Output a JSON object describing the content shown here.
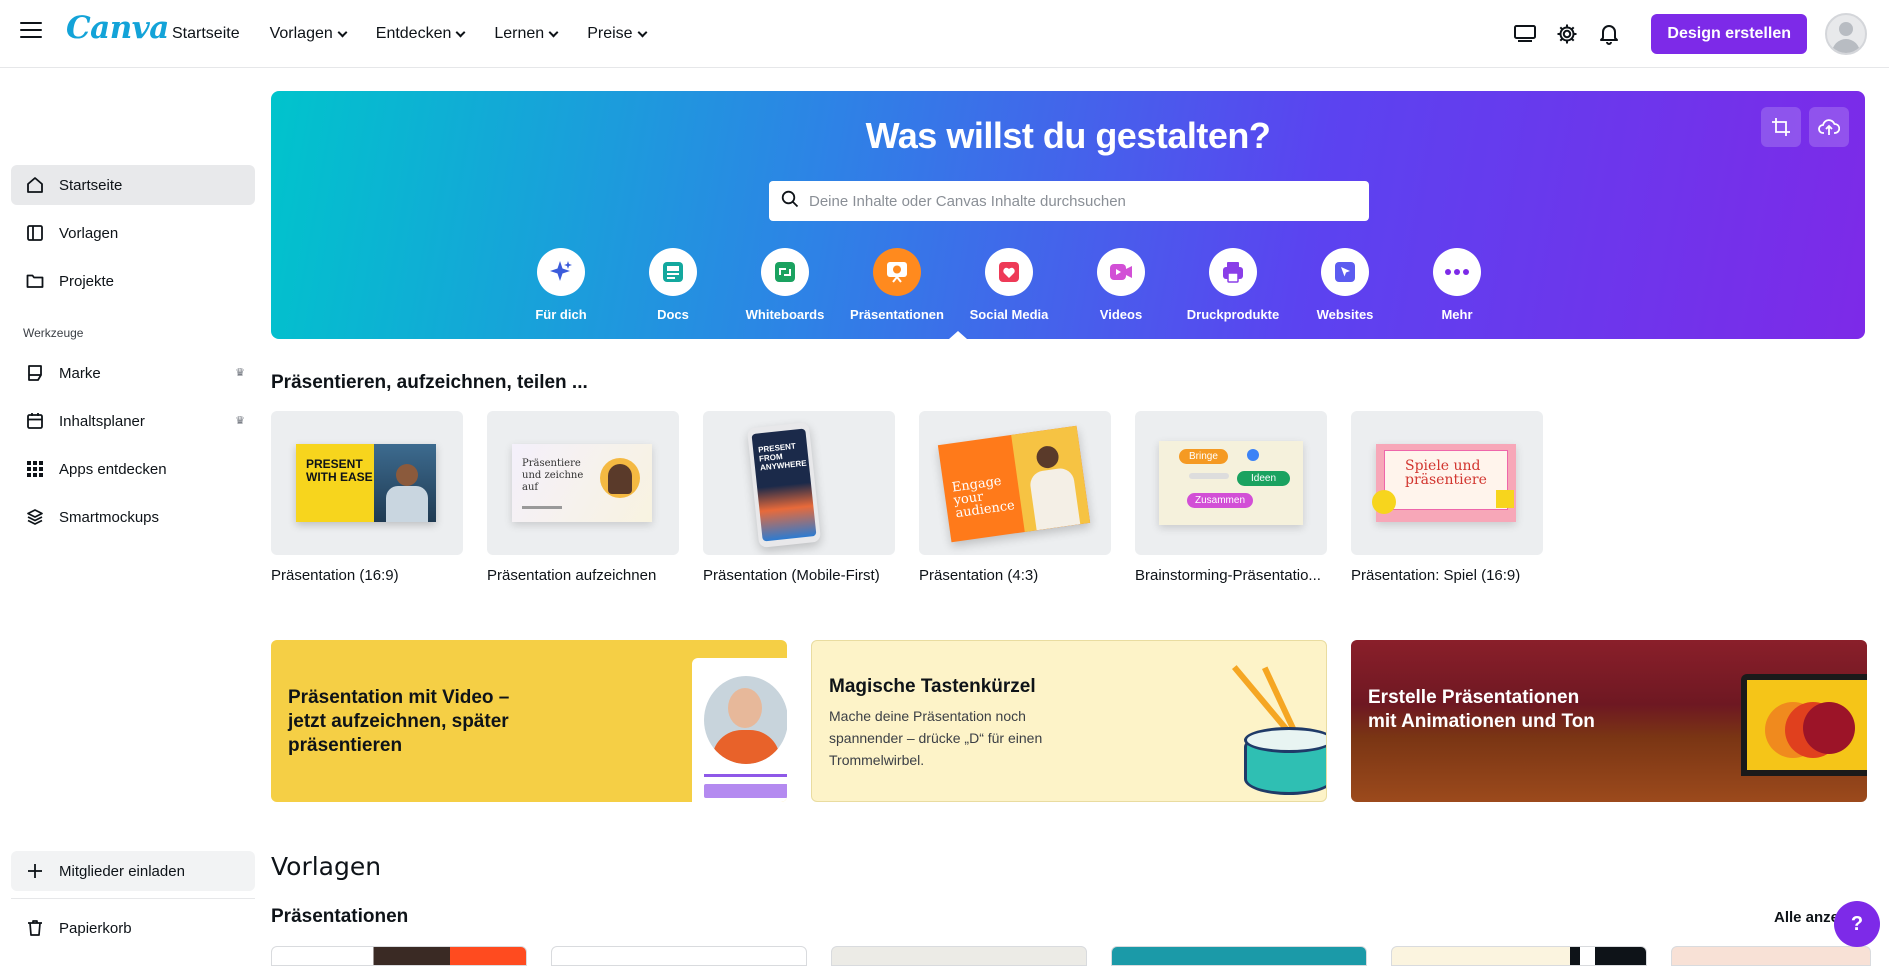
{
  "app": {
    "logo": "Canva"
  },
  "topnav": {
    "items": [
      "Startseite",
      "Vorlagen",
      "Entdecken",
      "Lernen",
      "Preise"
    ],
    "design_button": "Design erstellen"
  },
  "sidebar": {
    "items": [
      {
        "label": "Startseite",
        "icon": "home-icon"
      },
      {
        "label": "Vorlagen",
        "icon": "template-icon"
      },
      {
        "label": "Projekte",
        "icon": "folder-icon"
      }
    ],
    "tools_heading": "Werkzeuge",
    "tools": [
      {
        "label": "Marke",
        "icon": "brand-icon"
      },
      {
        "label": "Inhaltsplaner",
        "icon": "calendar-icon"
      },
      {
        "label": "Apps entdecken",
        "icon": "apps-icon"
      },
      {
        "label": "Smartmockups",
        "icon": "mockup-icon"
      }
    ],
    "invite": "Mitglieder einladen",
    "trash": "Papierkorb"
  },
  "hero": {
    "title": "Was willst du gestalten?",
    "search_placeholder": "Deine Inhalte oder Canvas Inhalte durchsuchen",
    "categories": [
      {
        "label": "Für dich",
        "icon": "sparkle-icon",
        "color": "#3b5bdb"
      },
      {
        "label": "Docs",
        "icon": "docs-icon",
        "color": "#13a89e"
      },
      {
        "label": "Whiteboards",
        "icon": "whiteboard-icon",
        "color": "#1aa260"
      },
      {
        "label": "Präsentationen",
        "icon": "presentation-icon",
        "color": "#ff8a1e"
      },
      {
        "label": "Social Media",
        "icon": "heart-icon",
        "color": "#ee3a57"
      },
      {
        "label": "Videos",
        "icon": "video-icon",
        "color": "#d24fd6"
      },
      {
        "label": "Druckprodukte",
        "icon": "print-icon",
        "color": "#8a3ee8"
      },
      {
        "label": "Websites",
        "icon": "cursor-icon",
        "color": "#5b5bf0"
      },
      {
        "label": "Mehr",
        "icon": "more-icon",
        "color": "#7d2ae8"
      }
    ],
    "active_category": "Präsentationen"
  },
  "present_section": {
    "title": "Präsentieren, aufzeichnen, teilen ...",
    "cards": [
      {
        "label": "Präsentation (16:9)",
        "thumb_text": "PRESENT WITH EASE"
      },
      {
        "label": "Präsentation aufzeichnen",
        "thumb_text": "Präsentiere und zeichne auf"
      },
      {
        "label": "Präsentation (Mobile-First)",
        "thumb_text": "PRESENT FROM ANYWHERE"
      },
      {
        "label": "Präsentation (4:3)",
        "thumb_text": "Engage your audience"
      },
      {
        "label": "Brainstorming-Präsentatio...",
        "thumb_text": [
          "Bringe",
          "Ideen",
          "Zusammen"
        ]
      },
      {
        "label": "Präsentation: Spiel (16:9)",
        "thumb_text": "Spiele und präsentiere"
      }
    ]
  },
  "banners": [
    {
      "title": "Präsentation mit Video – jetzt aufzeichnen, später präsentieren",
      "desc": "",
      "bg": "#f5cf45"
    },
    {
      "title": "Magische Tastenkürzel",
      "desc": "Mache deine Präsentation noch spannender – drücke „D“ für einen Trommelwirbel.",
      "bg": "#fdf3c8"
    },
    {
      "title": "Erstelle Präsentationen mit Animationen und Ton",
      "desc": "",
      "bg": "#7a1f23"
    }
  ],
  "templates_section": {
    "title": "Vorlagen",
    "subtitle": "Präsentationen",
    "see_all": "Alle anze"
  },
  "help": {
    "label": "?"
  }
}
